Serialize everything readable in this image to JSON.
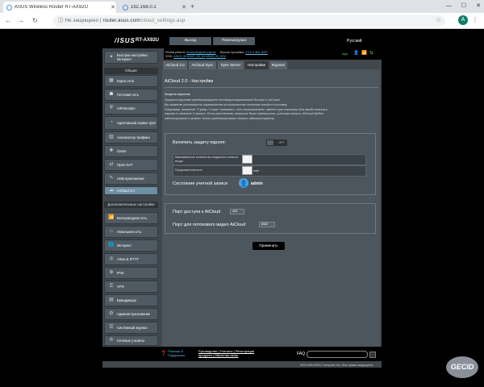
{
  "browser": {
    "tabs": [
      {
        "title": "ASUS Wireless Router RT-AX92U",
        "active": true
      },
      {
        "title": "192.168.0.1",
        "active": false
      }
    ],
    "address": {
      "security": "Не защищено",
      "host": "router.asus.com",
      "path": "/cloud_settings.asp"
    },
    "avatar_letter": "A"
  },
  "router": {
    "logo": "/ISUS",
    "model": "RT-AX92U",
    "header_buttons": [
      "Выход",
      "Перезагрузка"
    ],
    "language": "Русский",
    "info_line1": {
      "label": "Режим работы:",
      "mode": "Беспроводной роутер",
      "fw_label": "Версия прошивки:",
      "fw": "3.0.0.4.384_8057"
    },
    "info_line2": {
      "label": "SSID:",
      "ssid1": "ASUS_90",
      "ssid2": "ASUS_90_5G",
      "ssid3": "ASUS_90_5G2"
    },
    "app_label": "App",
    "quick_setup": "Быстрая настройка Интернет",
    "section_general": "Общие",
    "general_items": [
      "Карта сети",
      "Гостевая сеть",
      "AiProtection",
      "Адаптивный сервис QoS",
      "Анализатор трафика",
      "Game",
      "Open NAT",
      "USB-приложение",
      "AiCloud 2.0"
    ],
    "section_advanced": "Дополнительные настройки",
    "advanced_items": [
      "Беспроводная сеть",
      "Локальная сеть",
      "Интернет",
      "Alexa & IFTTT",
      "IPv6",
      "VPN",
      "Брандмауэр",
      "Администри-рование",
      "Системный журнал",
      "Сетевые утилиты"
    ],
    "content_tabs": [
      "AiCloud 2.0",
      "AiCloud Sync",
      "Sync Server",
      "Настройки",
      "Журнал"
    ],
    "page_title": "AiCloud 2.0 - Настройки",
    "desc_heading": "Защита паролем:",
    "desc_lines": [
      "Защита паролем предотвращает несанкционированный доступ к AiCloud.",
      "Вы можете установить ограничение на количество попыток входа в систему.",
      "Например, значение \"3 раза / 2 мин\" означает, что пользователь имеет три попытки для ввода логина и",
      "пароля в течение 2 минут. Если количество попыток было превышено, учетная запись AiCloud будет",
      "заблокирована и может быть разблокирована только администратор."
    ],
    "enable_password_label": "Включить защиту пароля:",
    "toggle_text": "OFF",
    "max_attempts_label": "Максимальное количество неудачных попыток входа",
    "duration_label": "Продолжительность",
    "duration_unit": "мин",
    "account_status_label": "Состояние учетной записи",
    "account_name": "admin",
    "port_label": "Порт доступа к AiCloud",
    "port_value": "443",
    "stream_port_label": "Порт для потокового видео AiCloud",
    "stream_port_value": "8082",
    "apply": "Применить",
    "help_lines": [
      "Помощь &",
      "Поддержка"
    ],
    "link_lines": [
      "Руководство | Утилиты | Регистрация",
      "продукта | Обратная связь"
    ],
    "faq": "FAQ",
    "copyright": "2020 ASUSTeK Computer Inc. Все права защищены."
  },
  "watermark": "GECID"
}
